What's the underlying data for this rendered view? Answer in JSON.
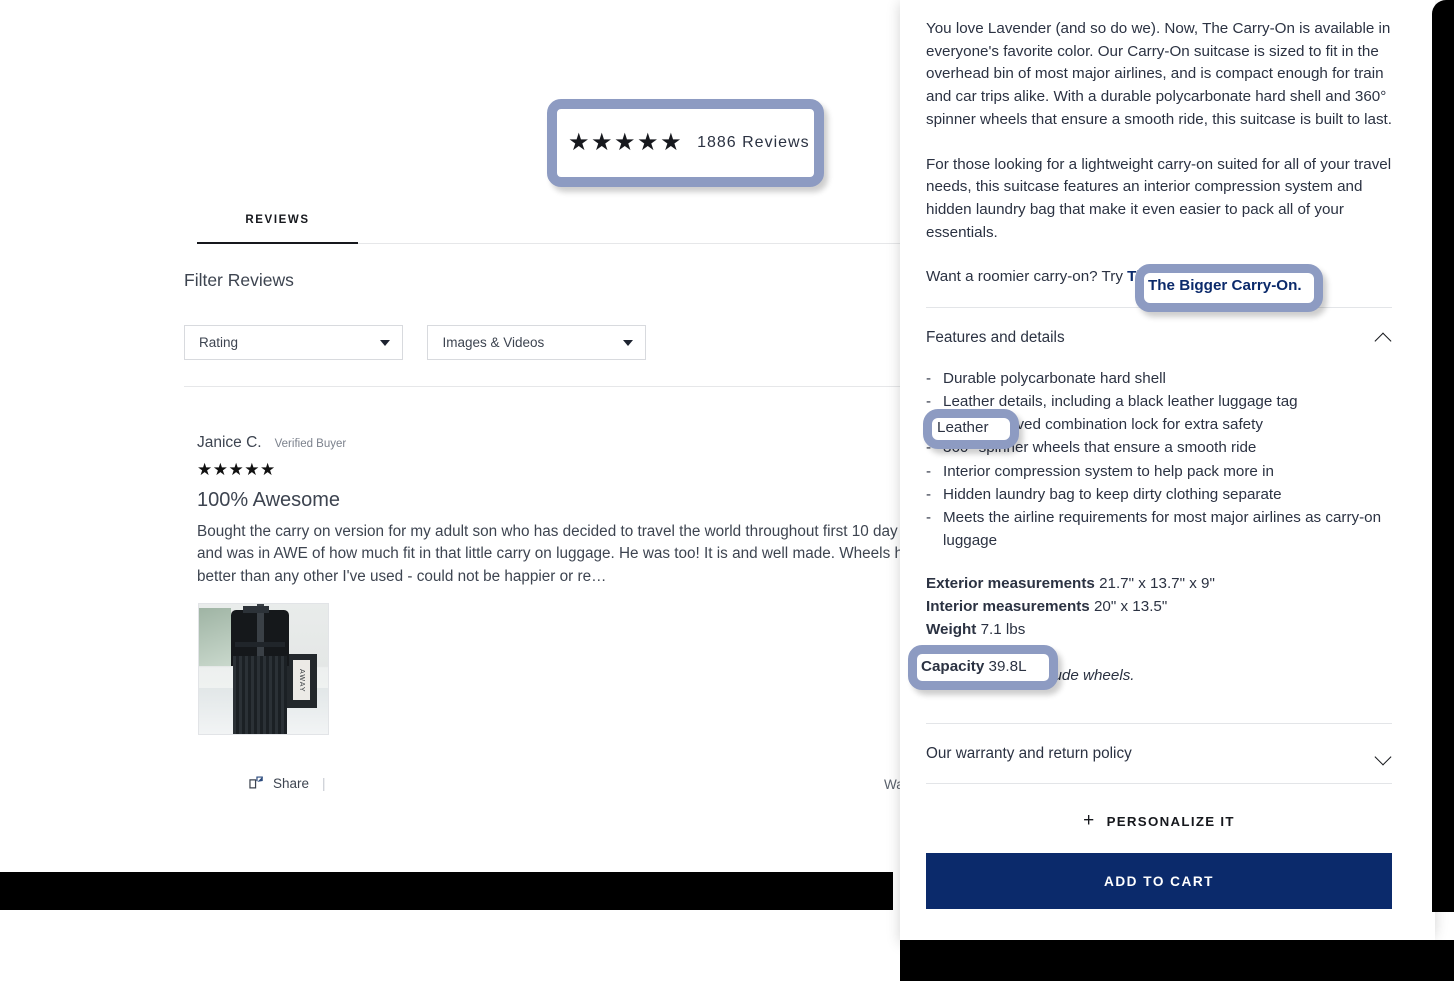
{
  "reviews_panel": {
    "rating_summary": {
      "stars_icon": "five-filled-stars",
      "stars": "★★★★★",
      "rating_value": 5,
      "count_label": "1886 Reviews",
      "review_count": 1886
    },
    "tabs": [
      {
        "label": "REVIEWS",
        "active": true
      }
    ],
    "filter_heading": "Filter Reviews",
    "filters": [
      {
        "name": "rating",
        "label": "Rating",
        "icon": "chevron-down-icon"
      },
      {
        "name": "media",
        "label": "Images & Videos",
        "icon": "chevron-down-icon"
      }
    ],
    "review": {
      "author": "Janice C.",
      "badge": "Verified Buyer",
      "stars": "★★★★★",
      "rating": 5,
      "title": "100% Awesome",
      "body": "Bought the carry on version for my adult son who has decided to travel the world throughout  first 10 day trip and was in AWE of how much fit in that little carry on luggage. He was too! It is  and well made. Wheels handle better than any other I've used - could not be happier or re…",
      "read_more": "Re",
      "photo_alt": "AWAY suitcase with backpack and luggage tag",
      "photo_tag_text": "AWAY",
      "share_label": "Share",
      "share_icon": "share-icon",
      "helpful_label": "Was"
    }
  },
  "product_panel": {
    "description": [
      "You love Lavender (and so do we). Now, The Carry-On is available in everyone's favorite color. Our Carry-On suitcase is sized to fit in the overhead bin of most major airlines, and is compact enough for train and car trips alike. With a durable polycarbonate hard shell and 360° spinner wheels that ensure a smooth ride, this suitcase is built to last.",
      "For those looking for a lightweight carry-on suited for all of your travel needs, this suitcase features an interior compression system and hidden laundry bag that make it even easier to pack all of your essentials."
    ],
    "cross_sell": {
      "prefix": "Want a roomier carry-on? Try ",
      "link": "The Bigger Carry-On",
      "suffix": "."
    },
    "features_section": {
      "title": "Features and details",
      "expanded": true,
      "toggle_icon": "chevron-up-icon",
      "items": [
        "Durable polycarbonate hard shell",
        "Leather details, including a black leather luggage tag",
        "TSA-approved combination lock for extra safety",
        "360° spinner wheels that ensure a smooth ride",
        "Interior compression system to help pack more in",
        "Hidden laundry bag to keep dirty clothing separate",
        "Meets the airline requirements for most major airlines as carry-on luggage"
      ],
      "measurements": [
        {
          "label": "Exterior measurements",
          "value": "21.7\" x 13.7\" x 9\""
        },
        {
          "label": "Interior measurements",
          "value": "20\" x 13.5\""
        },
        {
          "label": "Weight",
          "value": "7.1 lbs"
        },
        {
          "label": "Capacity",
          "value": "39.8L"
        }
      ],
      "note": "Measurements include wheels."
    },
    "warranty_section": {
      "title": "Our warranty and return policy",
      "expanded": false,
      "toggle_icon": "chevron-down-icon"
    },
    "personalize": {
      "icon": "plus-icon",
      "label": "PERSONALIZE IT"
    },
    "add_to_cart": {
      "label": "ADD TO CART",
      "color": "#0b2a6b"
    }
  },
  "annotations": {
    "highlight_color": "#8d9bc2",
    "boxes": [
      {
        "name": "rating-summary",
        "text": "1886 Reviews"
      },
      {
        "name": "bigger-carry-on-link",
        "text": "The Bigger Carry-On."
      },
      {
        "name": "leather-feature",
        "text": "Leather"
      },
      {
        "name": "capacity-measurement",
        "text": "Capacity 39.8L"
      }
    ]
  },
  "annotation_text": {
    "rating_stars": "★★★★★",
    "rating_count": "1886 Reviews",
    "bigger_link": "The Bigger Carry-On.",
    "leather": "Leather",
    "capacity_label": "Capacity",
    "capacity_value": " 39.8L"
  }
}
